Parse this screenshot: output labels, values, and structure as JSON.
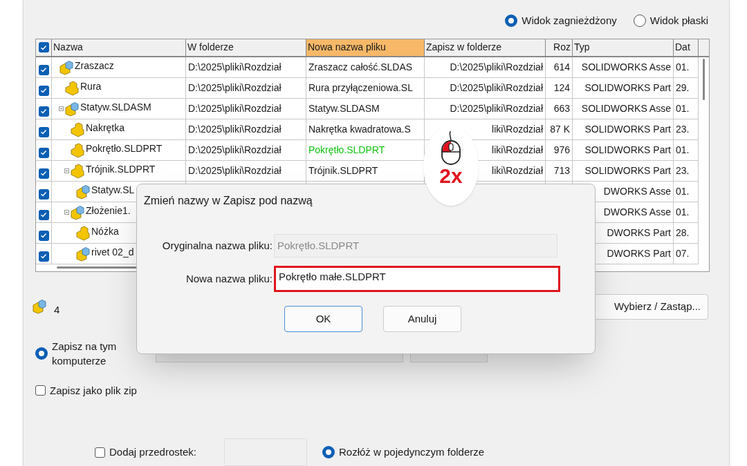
{
  "view_options": [
    {
      "label": "Widok zagnieżdżony",
      "selected": true
    },
    {
      "label": "Widok płaski",
      "selected": false
    }
  ],
  "table": {
    "all_checked": true,
    "name_column": {
      "label": "Nazwa",
      "selected": false
    },
    "columns": [
      {
        "label": "W folderze",
        "selected": false
      },
      {
        "label": "Nowa nazwa pliku",
        "selected": true
      },
      {
        "label": "Zapisz w folderze",
        "selected": false
      },
      {
        "label": "Roz",
        "selected": false
      },
      {
        "label": "Typ",
        "selected": false
      },
      {
        "label": "Dat",
        "selected": false
      }
    ],
    "rows": [
      {
        "name": "Zraszacz",
        "kind": "assembly",
        "checked": true,
        "expanded": false,
        "renamed": false,
        "cells": [
          "D:\\2025\\pliki\\Rozdział",
          "Zraszacz całość.SLDAS",
          "D:\\2025\\pliki\\Rozdział",
          "614",
          "SOLIDWORKS Asse",
          "01."
        ],
        "children": [
          {
            "name": "Rura",
            "kind": "part",
            "checked": true,
            "expanded": false,
            "renamed": false,
            "cells": [
              "D:\\2025\\pliki\\Rozdział",
              "Rura przyłączeniowa.SL",
              "D:\\2025\\pliki\\Rozdział",
              "124",
              "SOLIDWORKS Part",
              "29."
            ]
          },
          {
            "name": "Statyw.SLDASM",
            "kind": "assembly",
            "checked": true,
            "expanded": true,
            "renamed": false,
            "cells": [
              "D:\\2025\\pliki\\Rozdział",
              "Statyw.SLDASM",
              "D:\\2025\\pliki\\Rozdział",
              "663",
              "SOLIDWORKS Asse",
              "01."
            ],
            "children": [
              {
                "name": "Nakrętka",
                "kind": "part",
                "checked": true,
                "expanded": false,
                "renamed": false,
                "cells": [
                  "D:\\2025\\pliki\\Rozdział",
                  "Nakrętka kwadratowa.S",
                  "liki\\Rozdział",
                  "87 K",
                  "SOLIDWORKS Part",
                  "23."
                ]
              },
              {
                "name": "Pokrętło.SLDPRT",
                "kind": "part",
                "checked": true,
                "expanded": false,
                "renamed": true,
                "cells": [
                  "D:\\2025\\pliki\\Rozdział",
                  "Pokrętło.SLDPRT",
                  "liki\\Rozdział",
                  "976",
                  "SOLIDWORKS Part",
                  "01."
                ]
              },
              {
                "name": "Trójnik.SLDPRT",
                "kind": "part",
                "checked": true,
                "expanded": true,
                "renamed": false,
                "cells": [
                  "D:\\2025\\pliki\\Rozdział",
                  "Trójnik.SLDPRT",
                  "liki\\Rozdział",
                  "713",
                  "SOLIDWORKS Part",
                  "23."
                ],
                "children": [
                  {
                    "name": "Statyw.SL",
                    "kind": "assembly",
                    "checked": true,
                    "expanded": false,
                    "cells": [
                      "",
                      "",
                      "",
                      "",
                      "DWORKS Asse",
                      "01."
                    ]
                  }
                ]
              },
              {
                "name": "Złożenie1.",
                "kind": "assembly",
                "checked": true,
                "expanded": true,
                "cells": [
                  "",
                  "",
                  "",
                  "",
                  "DWORKS Asse",
                  "01."
                ],
                "children": [
                  {
                    "name": "Nóżka",
                    "kind": "part",
                    "checked": true,
                    "expanded": false,
                    "cells": [
                      "",
                      "",
                      "",
                      "",
                      "DWORKS Part",
                      "28."
                    ]
                  },
                  {
                    "name": "rivet 02_d",
                    "kind": "assembly",
                    "checked": true,
                    "expanded": false,
                    "cells": [
                      "",
                      "",
                      "",
                      "",
                      "DWORKS Part",
                      "07."
                    ]
                  }
                ]
              }
            ]
          }
        ]
      }
    ]
  },
  "summary": {
    "count": "4"
  },
  "replace_button": "Wybierz / Zastąp...",
  "location_options": [
    {
      "label": "Zapisz na tym komputerze",
      "selected": true
    }
  ],
  "zip_option": {
    "label": "Zapisz jako plik zip",
    "checked": false
  },
  "prefix_option": {
    "label": "Dodaj przedrostek:",
    "checked": false
  },
  "flatten_option": {
    "label": "Rozłóż w pojedynczym folderze",
    "selected": true
  },
  "dialog": {
    "title": "Zmień nazwy w Zapisz pod nazwą",
    "original_label": "Oryginalna nazwa pliku:",
    "original_value": "Pokrętło.SLDPRT",
    "new_label": "Nowa nazwa pliku:",
    "new_value": "Pokrętło małe.SLDPRT",
    "new_highlighted": true,
    "buttons": [
      {
        "label": "OK",
        "default": true
      },
      {
        "label": "Anuluj",
        "default": false
      }
    ]
  },
  "click_badge": {
    "text": "2x"
  }
}
